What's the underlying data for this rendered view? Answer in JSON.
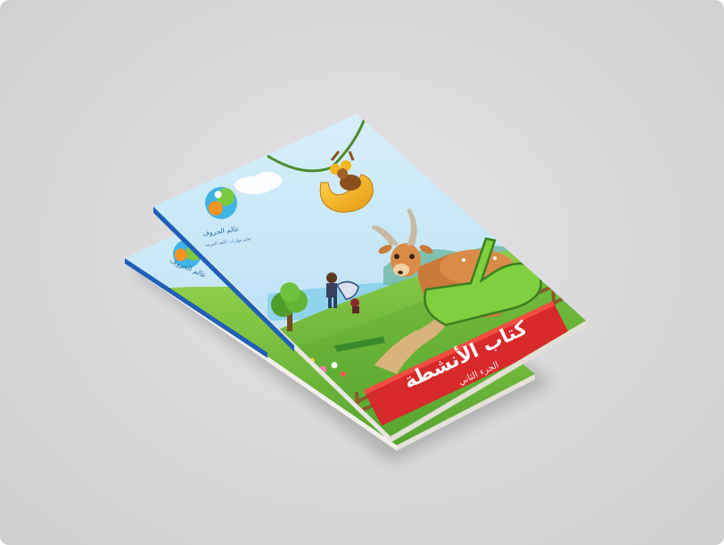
{
  "cover": {
    "title_main": "كتاب الأنشطة",
    "title_sub": "الجزء الثاني",
    "series_logo_text": "عالم الحروف",
    "series_tagline": "تعلم مهارات اللغة العربية",
    "letter_top": "ق",
    "letter_main": "ظ"
  },
  "back_cover": {
    "series_logo_text": "عالم الحروف"
  },
  "colors": {
    "sky": "#bfe3f5",
    "grass": "#6fb83a",
    "banner": "#d72a2a",
    "letter_gold": "#f2b61c",
    "letter_green": "#7fcf3f",
    "spine_blue": "#1f5fb8"
  },
  "icons": {
    "logo": "series-logo-icon",
    "deer": "deer-illustration",
    "monkey": "monkey-on-letter-illustration",
    "boy": "boy-carrying-letter-illustration",
    "tree": "tree-icon",
    "fence": "fence-icon",
    "flowers": "flower-icon",
    "clouds": "cloud-icon"
  }
}
